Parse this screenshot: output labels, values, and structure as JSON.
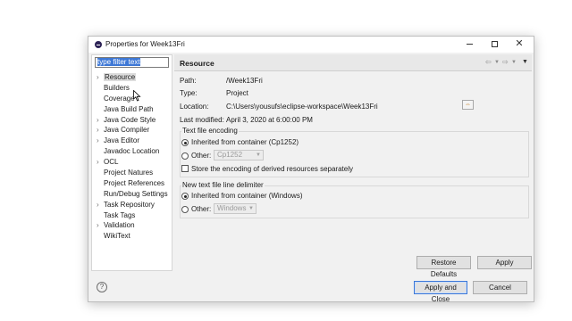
{
  "window": {
    "title": "Properties for Week13Fri",
    "minimize_icon": "minimize-icon",
    "maximize_icon": "maximize-icon",
    "close_icon": "close-icon"
  },
  "filter": {
    "placeholder": "type filter text",
    "value": "type filter text"
  },
  "nav": {
    "items": [
      {
        "label": "Resource",
        "expandable": true,
        "selected": true
      },
      {
        "label": "Builders",
        "expandable": false
      },
      {
        "label": "Coverage",
        "expandable": false
      },
      {
        "label": "Java Build Path",
        "expandable": false
      },
      {
        "label": "Java Code Style",
        "expandable": true
      },
      {
        "label": "Java Compiler",
        "expandable": true
      },
      {
        "label": "Java Editor",
        "expandable": true
      },
      {
        "label": "Javadoc Location",
        "expandable": false
      },
      {
        "label": "OCL",
        "expandable": true
      },
      {
        "label": "Project Natures",
        "expandable": false
      },
      {
        "label": "Project References",
        "expandable": false
      },
      {
        "label": "Run/Debug Settings",
        "expandable": false
      },
      {
        "label": "Task Repository",
        "expandable": true
      },
      {
        "label": "Task Tags",
        "expandable": false
      },
      {
        "label": "Validation",
        "expandable": true
      },
      {
        "label": "WikiText",
        "expandable": false
      }
    ]
  },
  "page": {
    "title": "Resource",
    "path_label": "Path:",
    "path_value": "/Week13Fri",
    "type_label": "Type:",
    "type_value": "Project",
    "location_label": "Location:",
    "location_value": "C:\\Users\\yousufs\\eclipse-workspace\\Week13Fri",
    "modified_label": "Last modified:",
    "modified_value": "April 3, 2020 at 6:00:00 PM"
  },
  "encoding": {
    "title": "Text file encoding",
    "inherited_label": "Inherited from container (Cp1252)",
    "other_label": "Other:",
    "other_value": "Cp1252",
    "store_label": "Store the encoding of derived resources separately"
  },
  "delimiter": {
    "title": "New text file line delimiter",
    "inherited_label": "Inherited from container (Windows)",
    "other_label": "Other:",
    "other_value": "Windows"
  },
  "buttons": {
    "restore_defaults": "Restore Defaults",
    "apply": "Apply",
    "apply_and_close": "Apply and Close",
    "cancel": "Cancel",
    "help": "?"
  },
  "colors": {
    "accent": "#3e78d6",
    "dialog_bg": "#f1f1f1"
  }
}
